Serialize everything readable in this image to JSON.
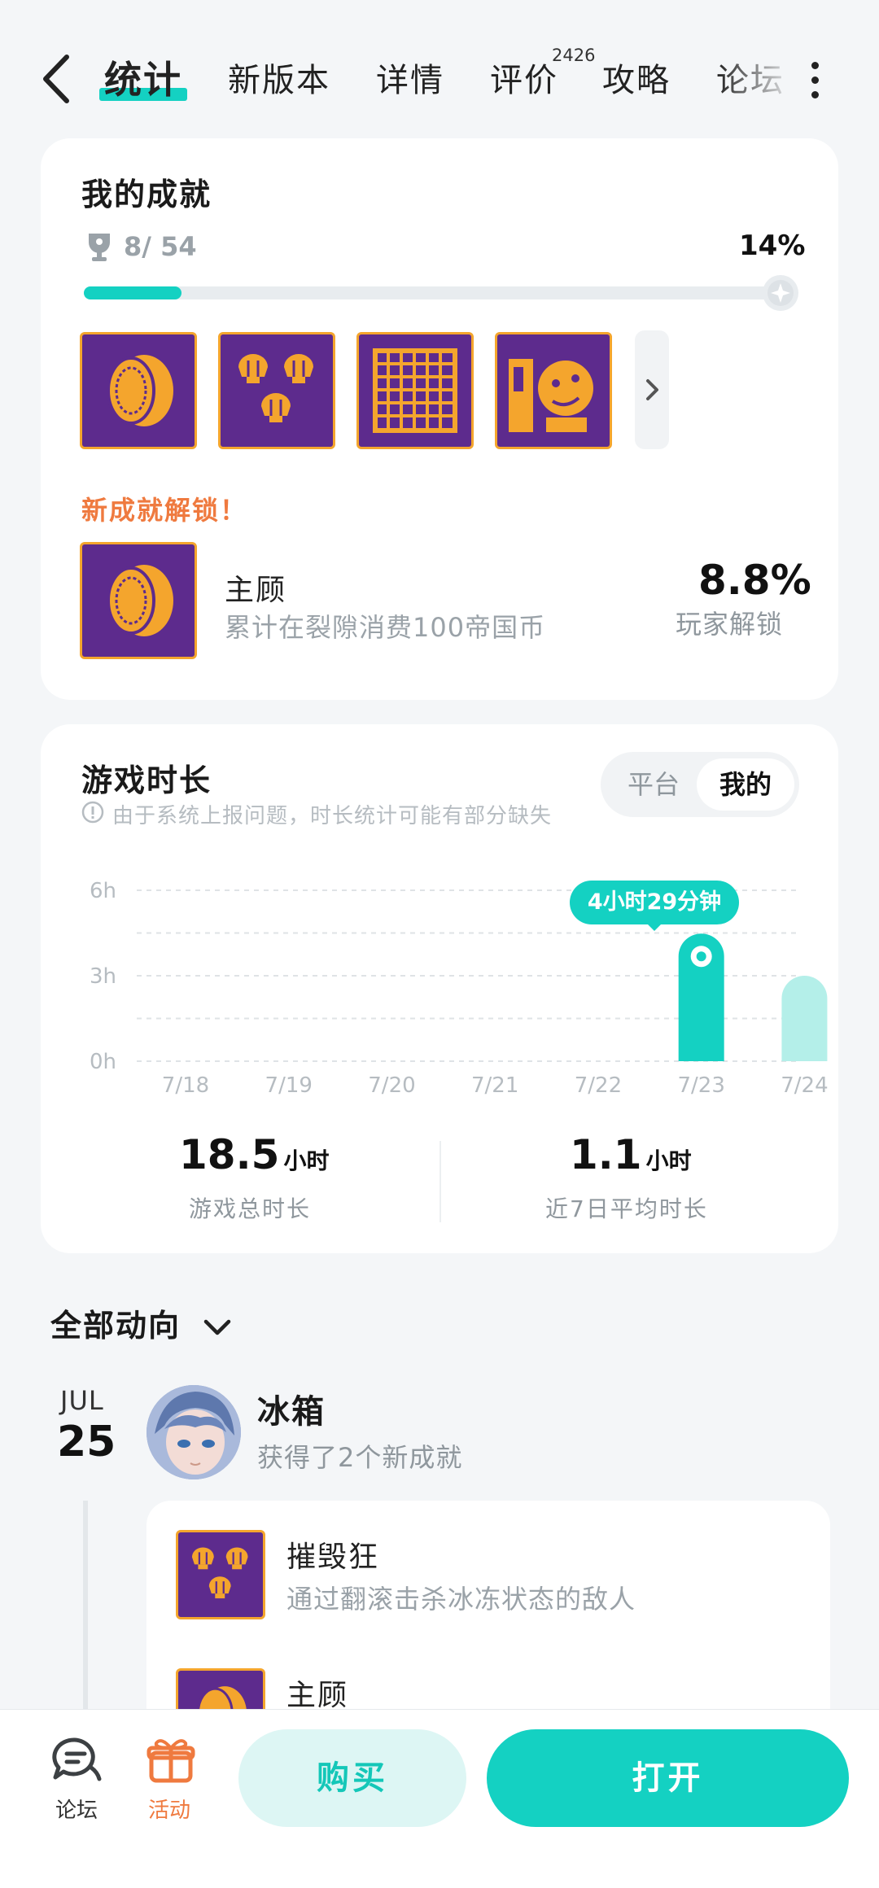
{
  "nav": {
    "tabs": [
      "统计",
      "新版本",
      "详情",
      "评价",
      "攻略",
      "论坛"
    ],
    "review_count": "2426"
  },
  "achievements": {
    "title": "我的成就",
    "count": "8/ 54",
    "percent": "14%",
    "progress": 0.14,
    "new_unlock_label": "新成就解锁！",
    "unlocked": {
      "name": "主顾",
      "desc": "累计在裂隙消费100帝国币",
      "rate": "8.8%",
      "rate_label": "玩家解锁"
    }
  },
  "playtime": {
    "title": "游戏时长",
    "notice": "由于系统上报问题，时长统计可能有部分缺失",
    "segment": [
      "平台",
      "我的"
    ],
    "tooltip": "4小时29分钟",
    "total_value": "18.5",
    "total_unit": "小时",
    "total_label": "游戏总时长",
    "avg_value": "1.1",
    "avg_unit": "小时",
    "avg_label": "近7日平均时长"
  },
  "chart_data": {
    "type": "bar",
    "categories": [
      "7/18",
      "7/19",
      "7/20",
      "7/21",
      "7/22",
      "7/23",
      "7/24"
    ],
    "values": [
      0,
      0,
      0,
      0,
      0,
      4.48,
      3.0
    ],
    "yticks": [
      "6h",
      "3h",
      "0h"
    ],
    "ylim": [
      0,
      6
    ],
    "selected": "7/23",
    "colors": {
      "selected": "#14d1c2",
      "other": "#b4efe9"
    }
  },
  "feed": {
    "filter_label": "全部动向",
    "month": "JUL",
    "day": "25",
    "user": "冰箱",
    "action": "获得了2个新成就",
    "items": [
      {
        "name": "摧毁狂",
        "desc": "通过翻滚击杀冰冻状态的敌人"
      },
      {
        "name": "主顾",
        "desc": ""
      }
    ]
  },
  "bottom": {
    "forum": "论坛",
    "activity": "活动",
    "buy": "购买",
    "open": "打开"
  }
}
